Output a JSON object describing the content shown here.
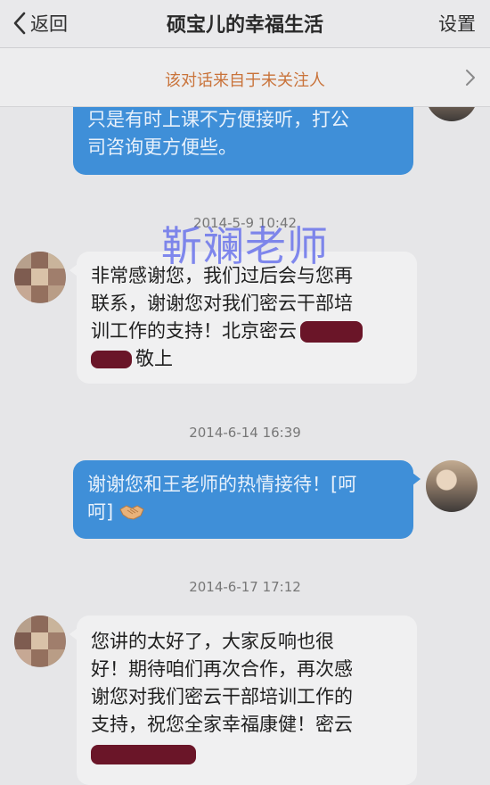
{
  "header": {
    "back_label": "返回",
    "title": "硕宝儿的幸福生活",
    "settings_label": "设置"
  },
  "notice": {
    "text": "该对话来自于未关注人"
  },
  "watermark": "靳斓老师",
  "messages": [
    {
      "lines": [
        "只是有时上课不方便接听，打公",
        "司咨询更方便些。"
      ]
    },
    {
      "timestamp": "2014-5-9 10:42",
      "lines": [
        "非常感谢您，我们过后会与您再",
        "联系，谢谢您对我们密云干部培",
        "训工作的支持！北京密云",
        "敬上"
      ]
    },
    {
      "timestamp": "2014-6-14 16:39",
      "lines": [
        "谢谢您和王老师的热情接待！[呵",
        "呵]"
      ]
    },
    {
      "timestamp": "2014-6-17 17:12",
      "lines": [
        "您讲的太好了，大家反响也很",
        "好！期待咱们再次合作，再次感",
        "谢您对我们密云干部培训工作的",
        "支持，祝您全家幸福康健！密云"
      ]
    }
  ],
  "colors": {
    "outgoing_bubble": "#3f8fd8",
    "incoming_bubble": "#f0f0f1",
    "notice_text": "#c9733a",
    "watermark": "#5a64eb",
    "redaction": "#6a1528"
  },
  "icons": {
    "back": "chevron-left-icon",
    "notice_arrow": "chevron-right-icon",
    "handshake": "handshake-emoji-icon"
  }
}
